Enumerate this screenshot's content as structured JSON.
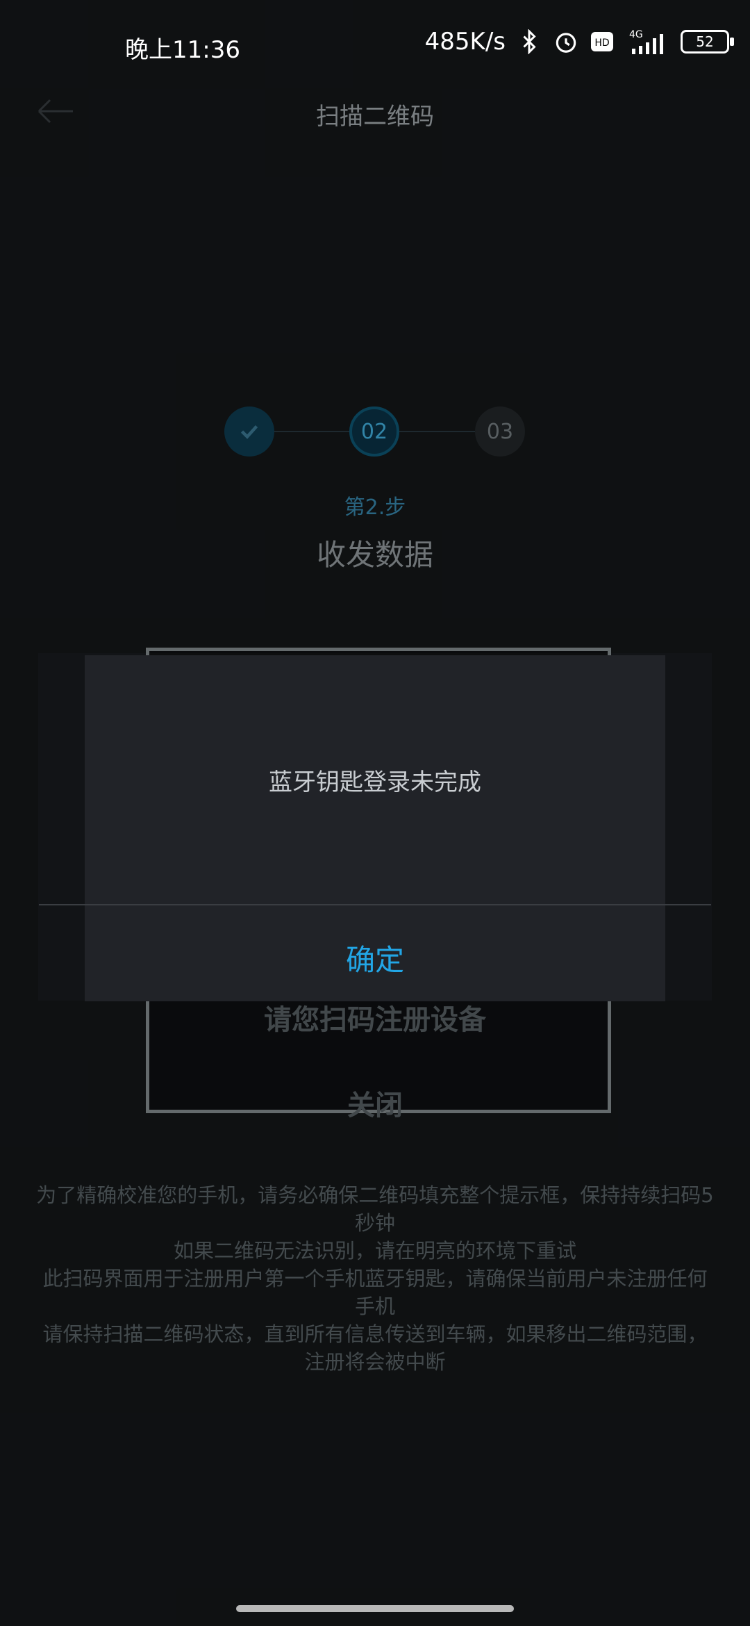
{
  "status_bar": {
    "time": "晚上11:36",
    "speed": "485K/s",
    "network": "4G",
    "battery": "52"
  },
  "header": {
    "title": "扫描二维码"
  },
  "steps": {
    "step2": "02",
    "step3": "03",
    "label": "第2.步",
    "title": "收发数据"
  },
  "scan": {
    "title": "请您扫码注册设备",
    "close": "关闭"
  },
  "instructions": [
    "为了精确校准您的手机，请务必确保二维码填充整个提示框，保持持续扫码5秒钟",
    "如果二维码无法识别，请在明亮的环境下重试",
    "此扫码界面用于注册用户第一个手机蓝牙钥匙，请确保当前用户未注册任何手机",
    "请保持扫描二维码状态，直到所有信息传送到车辆，如果移出二维码范围，注册将会被中断"
  ],
  "dialog": {
    "message": "蓝牙钥匙登录未完成",
    "ok": "确定"
  },
  "colors": {
    "accent": "#22a6e6",
    "dialog_bg": "#212328"
  },
  "icons": [
    "back-arrow-icon",
    "bluetooth-icon",
    "alarm-icon",
    "hd-icon",
    "signal-icon",
    "battery-icon",
    "check-icon"
  ]
}
